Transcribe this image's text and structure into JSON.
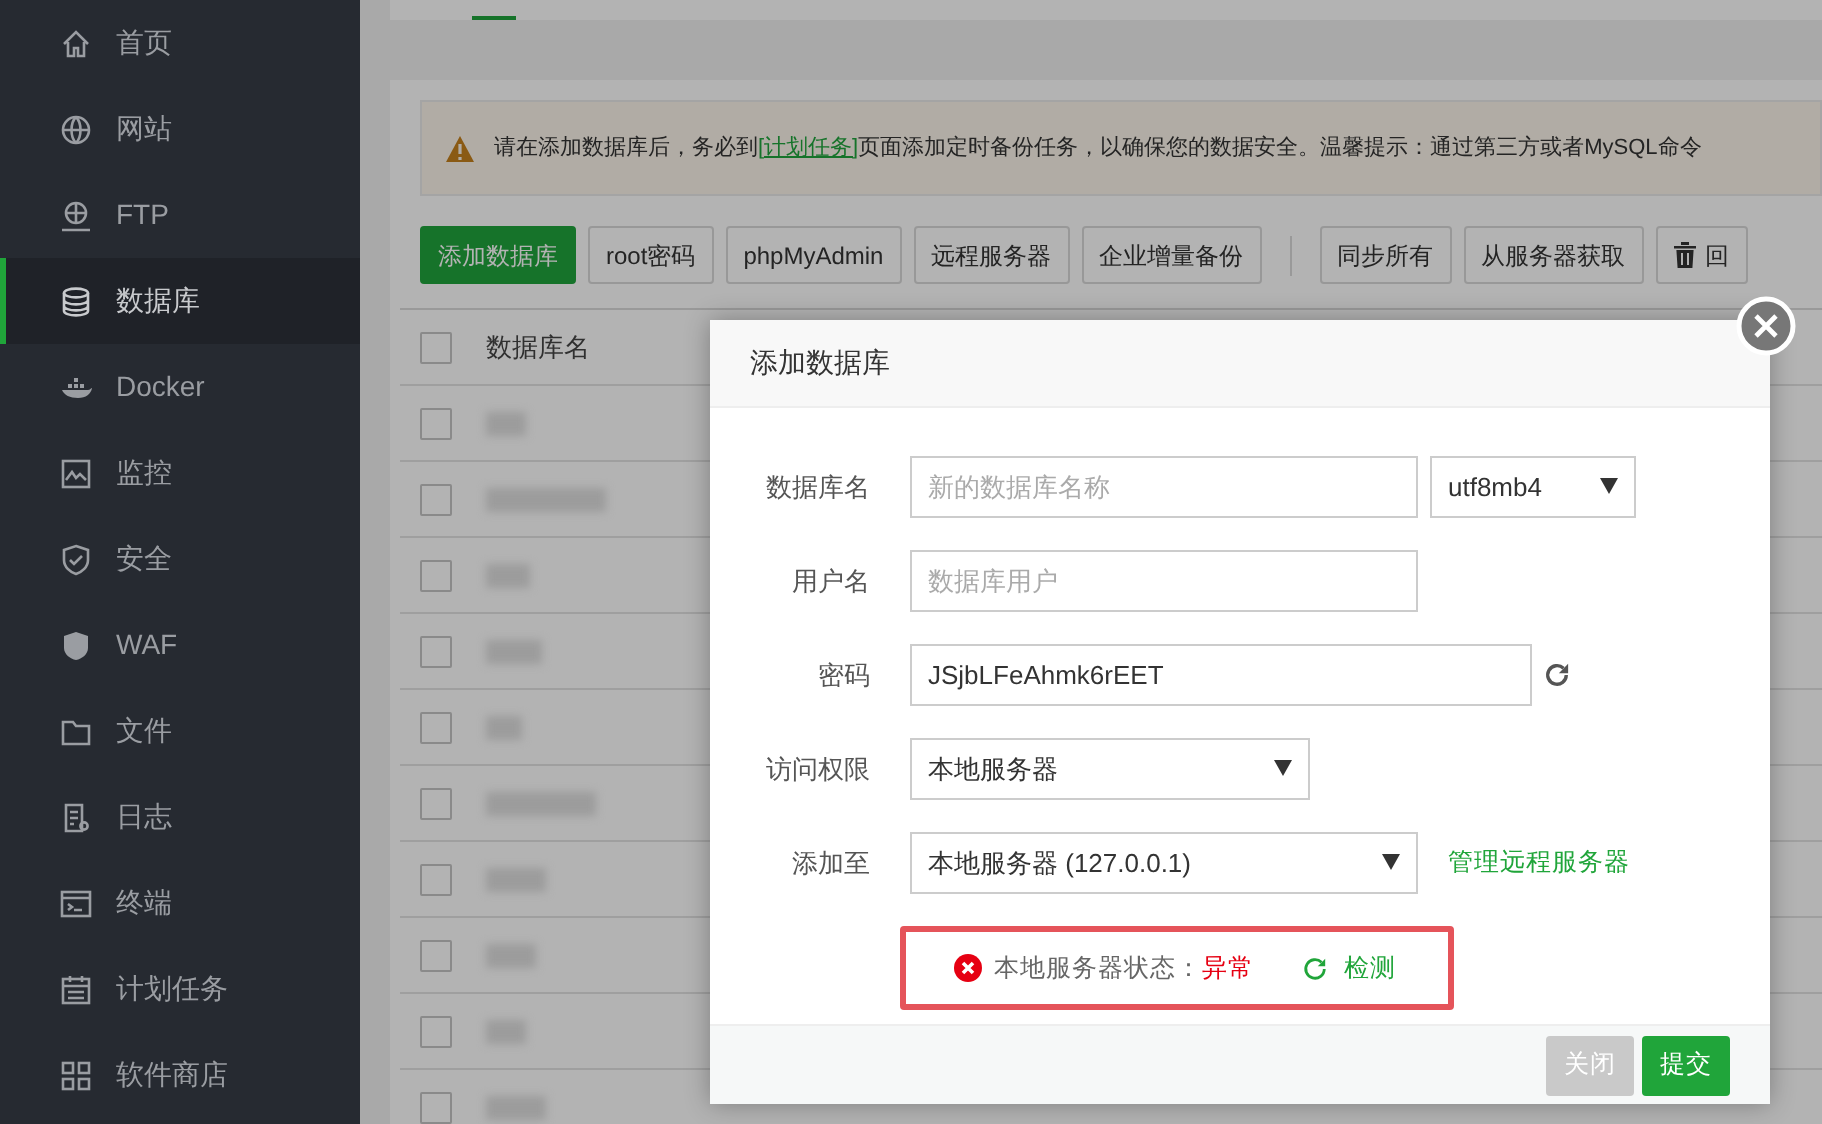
{
  "sidebar": {
    "items": [
      {
        "label": "首页",
        "selected": false
      },
      {
        "label": "网站",
        "selected": false
      },
      {
        "label": "FTP",
        "selected": false
      },
      {
        "label": "数据库",
        "selected": true
      },
      {
        "label": "Docker",
        "selected": false
      },
      {
        "label": "监控",
        "selected": false
      },
      {
        "label": "安全",
        "selected": false
      },
      {
        "label": "WAF",
        "selected": false
      },
      {
        "label": "文件",
        "selected": false
      },
      {
        "label": "日志",
        "selected": false
      },
      {
        "label": "终端",
        "selected": false
      },
      {
        "label": "计划任务",
        "selected": false
      },
      {
        "label": "软件商店",
        "selected": false
      }
    ]
  },
  "notice": {
    "before": "请在添加数据库后，务必到",
    "link": "[计划任务]",
    "after": "页面添加定时备份任务，以确保您的数据安全。温馨提示：通过第三方或者MySQL命令"
  },
  "toolbar": {
    "left": [
      {
        "label": "添加数据库",
        "kind": "primary"
      },
      {
        "label": "root密码",
        "kind": "default"
      },
      {
        "label": "phpMyAdmin",
        "kind": "default"
      },
      {
        "label": "远程服务器",
        "kind": "default"
      },
      {
        "label": "企业增量备份",
        "kind": "default"
      }
    ],
    "right": [
      {
        "label": "同步所有",
        "kind": "default"
      },
      {
        "label": "从服务器获取",
        "kind": "default"
      },
      {
        "label": "回",
        "kind": "trash"
      }
    ]
  },
  "table": {
    "columns": [
      "数据库名"
    ],
    "header_checked": false,
    "rows": [
      {
        "checked": false
      },
      {
        "checked": false
      },
      {
        "checked": false
      },
      {
        "checked": false
      },
      {
        "checked": false
      },
      {
        "checked": false
      },
      {
        "checked": false
      },
      {
        "checked": false
      },
      {
        "checked": false
      },
      {
        "checked": false
      }
    ]
  },
  "dialog": {
    "title": "添加数据库",
    "fields": [
      {
        "kind": "text-select",
        "label": "数据库名",
        "placeholder": "新的数据库名称",
        "option": "utf8mb4"
      },
      {
        "kind": "text",
        "label": "用户名",
        "placeholder": "数据库用户"
      },
      {
        "kind": "password",
        "label": "密码",
        "value": "JSjbLFeAhmk6rEET"
      },
      {
        "kind": "select",
        "label": "访问权限",
        "value": "本地服务器"
      },
      {
        "kind": "select-link",
        "label": "添加至",
        "value": "本地服务器 (127.0.0.1)",
        "link": "管理远程服务器"
      }
    ],
    "status": {
      "label": "本地服务器状态：",
      "state": "异常",
      "ok": false,
      "action": "检测"
    },
    "buttons": [
      {
        "label": "关闭",
        "kind": "secondary"
      },
      {
        "label": "提交",
        "kind": "primary"
      }
    ]
  }
}
